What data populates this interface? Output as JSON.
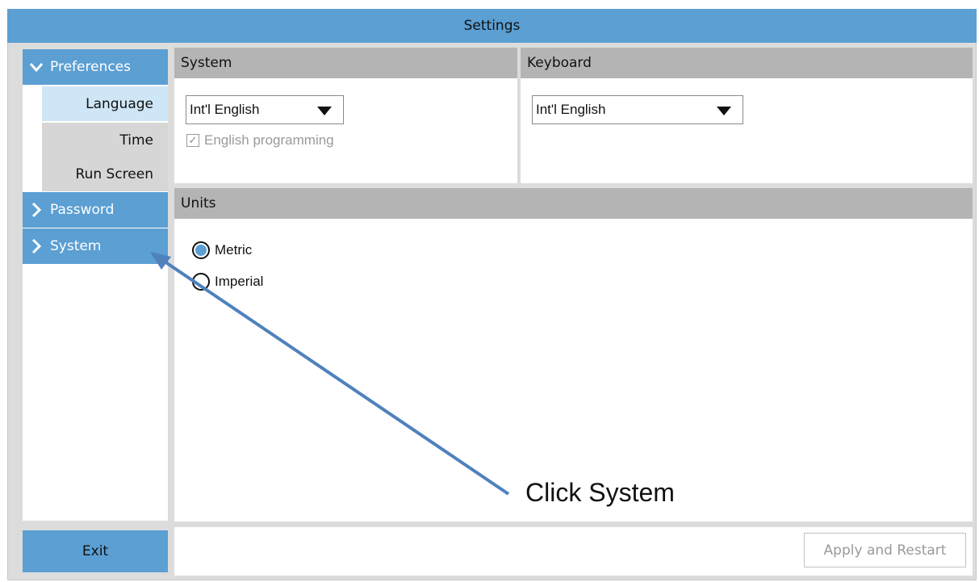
{
  "window": {
    "title": "Settings"
  },
  "sidebar": {
    "items": [
      {
        "label": "Preferences",
        "expanded": true
      },
      {
        "label": "Language",
        "active": true
      },
      {
        "label": "Time"
      },
      {
        "label": "Run Screen"
      },
      {
        "label": "Password",
        "expanded": false
      },
      {
        "label": "System",
        "expanded": false
      }
    ],
    "exit_label": "Exit"
  },
  "system_panel": {
    "title": "System",
    "language_select": {
      "value": "Int'l English"
    },
    "english_programming": {
      "label": "English programming",
      "checked": true,
      "disabled": true
    }
  },
  "keyboard_panel": {
    "title": "Keyboard",
    "keyboard_select": {
      "value": "Int'l English"
    }
  },
  "units_panel": {
    "title": "Units",
    "options": [
      {
        "label": "Metric",
        "selected": true
      },
      {
        "label": "Imperial",
        "selected": false
      }
    ]
  },
  "footer": {
    "apply_label": "Apply and Restart"
  },
  "annotation": {
    "text": "Click System"
  },
  "colors": {
    "accent": "#5b9fd3",
    "active_item": "#cfe6f7",
    "panel_header": "#b4b4b4",
    "arrow": "#4f81bd"
  },
  "icons": {
    "expanded": "chevron-down-icon",
    "collapsed": "chevron-right-icon",
    "dropdown": "caret-down-icon",
    "checkbox": "check-icon"
  }
}
